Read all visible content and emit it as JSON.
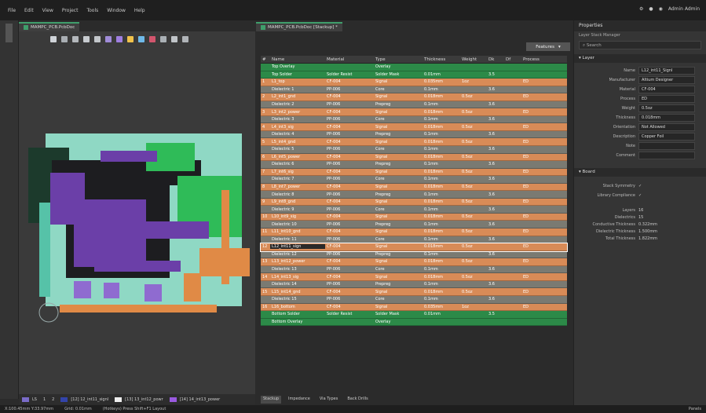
{
  "menu": [
    "File",
    "Edit",
    "View",
    "Project",
    "Tools",
    "Window",
    "Help"
  ],
  "user_label": "Admin Admin",
  "left_doc_tab": "MAMPC_PCB.PcbDoc",
  "right_doc_tab": "MAMPC_PCB.PcbDoc [Stackup] *",
  "features_button": "Features",
  "table": {
    "headers": [
      "#",
      "Name",
      "Material",
      "Type",
      "Thickness",
      "Weight",
      "Dk",
      "Df",
      "Process"
    ],
    "rows": [
      {
        "n": "",
        "name": "Top Overlay",
        "mat": "",
        "type": "Overlay",
        "th": "",
        "w": "",
        "dk": "",
        "df": "",
        "pr": "",
        "cls": "r-green"
      },
      {
        "n": "",
        "name": "Top Solder",
        "mat": "Solder Resist",
        "type": "Solder Mask",
        "th": "0.01mm",
        "w": "",
        "dk": "3.5",
        "df": "",
        "pr": "",
        "cls": "r-green"
      },
      {
        "n": "1",
        "name": "L1_top",
        "mat": "CF-004",
        "type": "Signal",
        "th": "0.035mm",
        "w": "1oz",
        "dk": "",
        "df": "",
        "pr": "ED",
        "cls": "r-orange"
      },
      {
        "n": "",
        "name": "Dielectric 1",
        "mat": "PP-006",
        "type": "Core",
        "th": "0.1mm",
        "w": "",
        "dk": "3.6",
        "df": "",
        "pr": "",
        "cls": "r-gray"
      },
      {
        "n": "2",
        "name": "L2_int1_gnd",
        "mat": "CF-004",
        "type": "Signal",
        "th": "0.018mm",
        "w": "0.5oz",
        "dk": "",
        "df": "",
        "pr": "ED",
        "cls": "r-orange"
      },
      {
        "n": "",
        "name": "Dielectric 2",
        "mat": "PP-006",
        "type": "Prepreg",
        "th": "0.1mm",
        "w": "",
        "dk": "3.6",
        "df": "",
        "pr": "",
        "cls": "r-gray"
      },
      {
        "n": "3",
        "name": "L3_int2_power",
        "mat": "CF-004",
        "type": "Signal",
        "th": "0.018mm",
        "w": "0.5oz",
        "dk": "",
        "df": "",
        "pr": "ED",
        "cls": "r-orange"
      },
      {
        "n": "",
        "name": "Dielectric 3",
        "mat": "PP-006",
        "type": "Core",
        "th": "0.1mm",
        "w": "",
        "dk": "3.6",
        "df": "",
        "pr": "",
        "cls": "r-gray"
      },
      {
        "n": "4",
        "name": "L4_int3_sig",
        "mat": "CF-004",
        "type": "Signal",
        "th": "0.018mm",
        "w": "0.5oz",
        "dk": "",
        "df": "",
        "pr": "ED",
        "cls": "r-orange"
      },
      {
        "n": "",
        "name": "Dielectric 4",
        "mat": "PP-006",
        "type": "Prepreg",
        "th": "0.1mm",
        "w": "",
        "dk": "3.6",
        "df": "",
        "pr": "",
        "cls": "r-gray"
      },
      {
        "n": "5",
        "name": "L5_int4_gnd",
        "mat": "CF-004",
        "type": "Signal",
        "th": "0.018mm",
        "w": "0.5oz",
        "dk": "",
        "df": "",
        "pr": "ED",
        "cls": "r-orange"
      },
      {
        "n": "",
        "name": "Dielectric 5",
        "mat": "PP-006",
        "type": "Core",
        "th": "0.1mm",
        "w": "",
        "dk": "3.6",
        "df": "",
        "pr": "",
        "cls": "r-gray"
      },
      {
        "n": "6",
        "name": "L6_int5_power",
        "mat": "CF-004",
        "type": "Signal",
        "th": "0.018mm",
        "w": "0.5oz",
        "dk": "",
        "df": "",
        "pr": "ED",
        "cls": "r-orange"
      },
      {
        "n": "",
        "name": "Dielectric 6",
        "mat": "PP-006",
        "type": "Prepreg",
        "th": "0.1mm",
        "w": "",
        "dk": "3.6",
        "df": "",
        "pr": "",
        "cls": "r-gray"
      },
      {
        "n": "7",
        "name": "L7_int6_sig",
        "mat": "CF-004",
        "type": "Signal",
        "th": "0.018mm",
        "w": "0.5oz",
        "dk": "",
        "df": "",
        "pr": "ED",
        "cls": "r-orange"
      },
      {
        "n": "",
        "name": "Dielectric 7",
        "mat": "PP-006",
        "type": "Core",
        "th": "0.1mm",
        "w": "",
        "dk": "3.6",
        "df": "",
        "pr": "",
        "cls": "r-gray"
      },
      {
        "n": "8",
        "name": "L8_int7_power",
        "mat": "CF-004",
        "type": "Signal",
        "th": "0.018mm",
        "w": "0.5oz",
        "dk": "",
        "df": "",
        "pr": "ED",
        "cls": "r-orange"
      },
      {
        "n": "",
        "name": "Dielectric 8",
        "mat": "PP-006",
        "type": "Prepreg",
        "th": "0.1mm",
        "w": "",
        "dk": "3.6",
        "df": "",
        "pr": "",
        "cls": "r-gray"
      },
      {
        "n": "9",
        "name": "L9_int8_gnd",
        "mat": "CF-004",
        "type": "Signal",
        "th": "0.018mm",
        "w": "0.5oz",
        "dk": "",
        "df": "",
        "pr": "ED",
        "cls": "r-orange"
      },
      {
        "n": "",
        "name": "Dielectric 9",
        "mat": "PP-006",
        "type": "Core",
        "th": "0.1mm",
        "w": "",
        "dk": "3.6",
        "df": "",
        "pr": "",
        "cls": "r-gray"
      },
      {
        "n": "10",
        "name": "L10_int9_sig",
        "mat": "CF-004",
        "type": "Signal",
        "th": "0.018mm",
        "w": "0.5oz",
        "dk": "",
        "df": "",
        "pr": "ED",
        "cls": "r-orange"
      },
      {
        "n": "",
        "name": "Dielectric 10",
        "mat": "PP-006",
        "type": "Prepreg",
        "th": "0.1mm",
        "w": "",
        "dk": "3.6",
        "df": "",
        "pr": "",
        "cls": "r-gray"
      },
      {
        "n": "11",
        "name": "L11_int10_gnd",
        "mat": "CF-004",
        "type": "Signal",
        "th": "0.018mm",
        "w": "0.5oz",
        "dk": "",
        "df": "",
        "pr": "ED",
        "cls": "r-orange"
      },
      {
        "n": "",
        "name": "Dielectric 11",
        "mat": "PP-006",
        "type": "Core",
        "th": "0.1mm",
        "w": "",
        "dk": "3.6",
        "df": "",
        "pr": "",
        "cls": "r-gray"
      },
      {
        "n": "12",
        "name": "L12_int11_sign",
        "mat": "CF-004",
        "type": "Signal",
        "th": "0.018mm",
        "w": "0.5oz",
        "dk": "",
        "df": "",
        "pr": "ED",
        "cls": "r-sel"
      },
      {
        "n": "",
        "name": "Dielectric 12",
        "mat": "PP-006",
        "type": "Prepreg",
        "th": "0.1mm",
        "w": "",
        "dk": "3.6",
        "df": "",
        "pr": "",
        "cls": "r-gray"
      },
      {
        "n": "13",
        "name": "L13_int12_power",
        "mat": "CF-004",
        "type": "Signal",
        "th": "0.018mm",
        "w": "0.5oz",
        "dk": "",
        "df": "",
        "pr": "ED",
        "cls": "r-orange"
      },
      {
        "n": "",
        "name": "Dielectric 13",
        "mat": "PP-006",
        "type": "Core",
        "th": "0.1mm",
        "w": "",
        "dk": "3.6",
        "df": "",
        "pr": "",
        "cls": "r-gray"
      },
      {
        "n": "14",
        "name": "L14_int13_sig",
        "mat": "CF-004",
        "type": "Signal",
        "th": "0.018mm",
        "w": "0.5oz",
        "dk": "",
        "df": "",
        "pr": "ED",
        "cls": "r-orange"
      },
      {
        "n": "",
        "name": "Dielectric 14",
        "mat": "PP-006",
        "type": "Prepreg",
        "th": "0.1mm",
        "w": "",
        "dk": "3.6",
        "df": "",
        "pr": "",
        "cls": "r-gray"
      },
      {
        "n": "15",
        "name": "L15_int14_gnd",
        "mat": "CF-004",
        "type": "Signal",
        "th": "0.018mm",
        "w": "0.5oz",
        "dk": "",
        "df": "",
        "pr": "ED",
        "cls": "r-orange"
      },
      {
        "n": "",
        "name": "Dielectric 15",
        "mat": "PP-006",
        "type": "Core",
        "th": "0.1mm",
        "w": "",
        "dk": "3.6",
        "df": "",
        "pr": "",
        "cls": "r-gray"
      },
      {
        "n": "16",
        "name": "L16_bottom",
        "mat": "CF-004",
        "type": "Signal",
        "th": "0.035mm",
        "w": "1oz",
        "dk": "",
        "df": "",
        "pr": "ED",
        "cls": "r-orange"
      },
      {
        "n": "",
        "name": "Bottom Solder",
        "mat": "Solder Resist",
        "type": "Solder Mask",
        "th": "0.01mm",
        "w": "",
        "dk": "3.5",
        "df": "",
        "pr": "",
        "cls": "r-green"
      },
      {
        "n": "",
        "name": "Bottom Overlay",
        "mat": "",
        "type": "Overlay",
        "th": "",
        "w": "",
        "dk": "",
        "df": "",
        "pr": "",
        "cls": "r-green"
      }
    ]
  },
  "bottom_tabs": [
    "Stackup",
    "Impedance",
    "Via Types",
    "Back Drills"
  ],
  "layer_bar": {
    "items": [
      "LS",
      "1",
      "2",
      "[12] 12_int11_signl",
      "[13] 13_int12_powr",
      "[14] 14_int13_power"
    ]
  },
  "props": {
    "title": "Properties",
    "subtitle": "Layer Stack Manager",
    "search_placeholder": "Search",
    "layer_section": "Layer",
    "fields": [
      {
        "label": "Name",
        "value": "L12_int11_Signl"
      },
      {
        "label": "Manufacturer",
        "value": "Altium Designer"
      },
      {
        "label": "Material",
        "value": "CF-004"
      },
      {
        "label": "Process",
        "value": "ED"
      },
      {
        "label": "Weight",
        "value": "0.5oz"
      },
      {
        "label": "Thickness",
        "value": "0.018mm"
      },
      {
        "label": "Orientation",
        "value": "Not Allowed"
      },
      {
        "label": "Description",
        "value": "Copper Foil"
      },
      {
        "label": "Note",
        "value": ""
      },
      {
        "label": "Comment",
        "value": ""
      }
    ],
    "board_section": "Board",
    "board_checks": [
      {
        "label": "Stack Symmetry",
        "value": "✓"
      },
      {
        "label": "Library Compliance",
        "value": "✓"
      }
    ],
    "board_stats": [
      {
        "label": "Layers",
        "value": "16"
      },
      {
        "label": "Dielectrics",
        "value": "15"
      },
      {
        "label": "Conductive Thickness",
        "value": "0.322mm"
      },
      {
        "label": "Dielectric Thickness",
        "value": "1.500mm"
      },
      {
        "label": "Total Thickness",
        "value": "1.822mm"
      }
    ]
  },
  "status": {
    "left": "X:100.45mm Y:33.97mm",
    "grid": "Grid: 0.01mm",
    "hint": "(Hotkeys) Press Shift+F1 Layout",
    "right": "Panels"
  }
}
